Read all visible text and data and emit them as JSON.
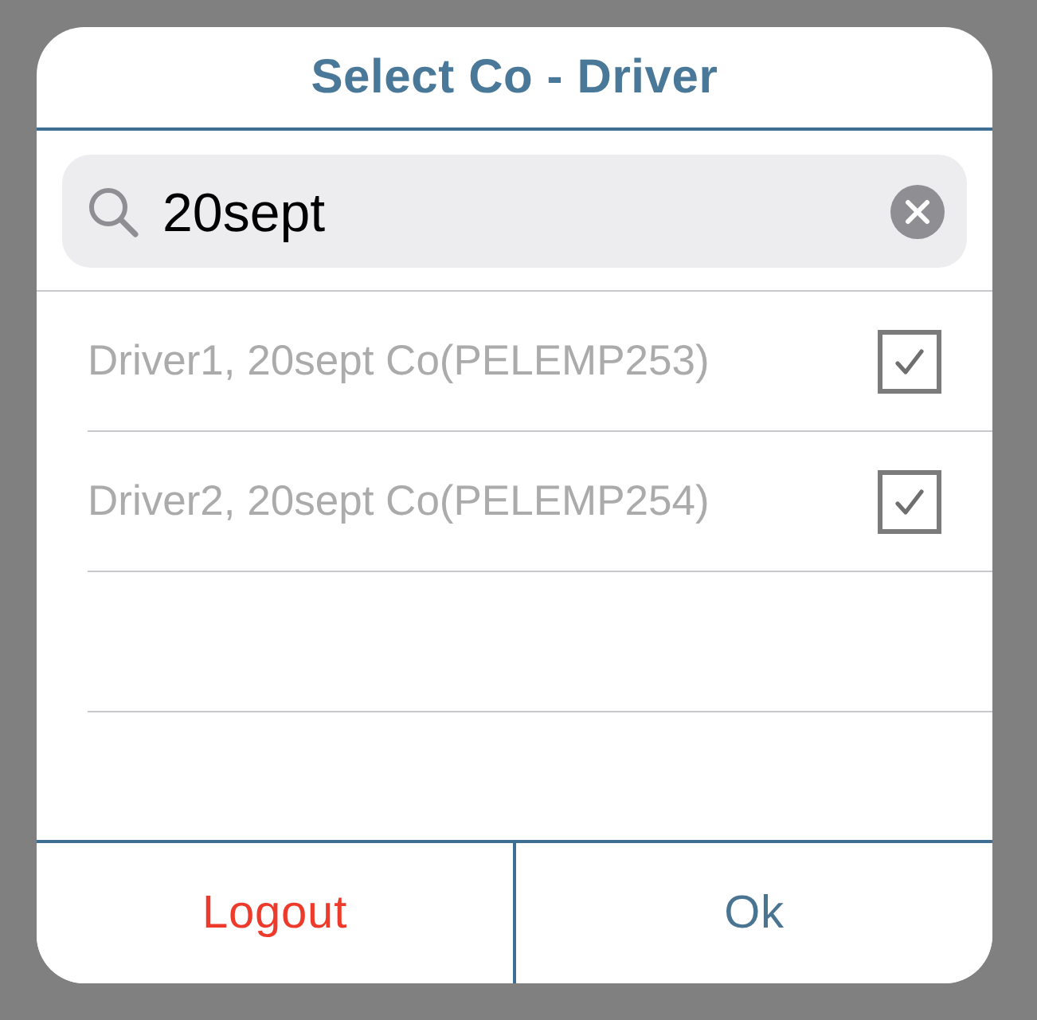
{
  "dialog": {
    "title": "Select Co - Driver"
  },
  "search": {
    "value": "20sept"
  },
  "drivers": [
    {
      "label": "Driver1, 20sept Co(PELEMP253)",
      "checked": true
    },
    {
      "label": "Driver2, 20sept Co(PELEMP254)",
      "checked": true
    }
  ],
  "buttons": [
    {
      "label": "Logout",
      "kind": "cancel"
    },
    {
      "label": "Ok",
      "kind": "confirm"
    }
  ]
}
